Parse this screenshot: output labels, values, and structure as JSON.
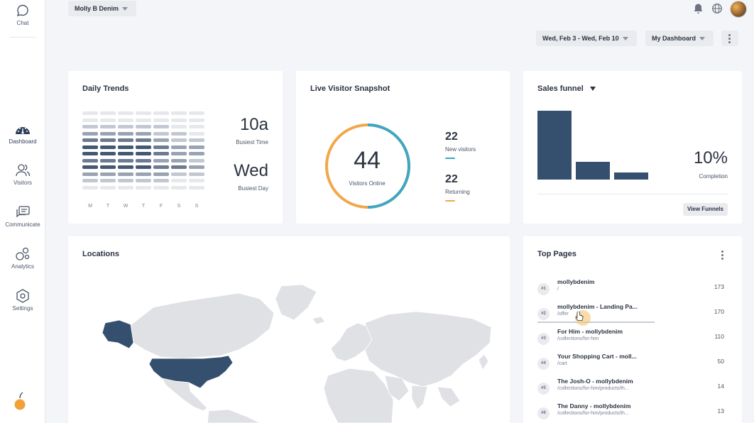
{
  "sidebar": {
    "items": [
      {
        "label": "Chat",
        "icon": "chat-bubble-icon"
      },
      {
        "label": "Dashboard",
        "icon": "speedometer-icon"
      },
      {
        "label": "Visitors",
        "icon": "users-icon"
      },
      {
        "label": "Communicate",
        "icon": "message-icon"
      },
      {
        "label": "Analytics",
        "icon": "bubbles-icon"
      },
      {
        "label": "Settings",
        "icon": "hexagon-gear-icon"
      }
    ],
    "logo_icon": "orange-fruit-logo"
  },
  "header": {
    "site_select": "Molly B Denim",
    "date_range": "Wed, Feb 3 - Wed, Feb 10",
    "dashboard_select": "My Dashboard"
  },
  "daily_trends": {
    "title": "Daily Trends",
    "days": [
      "M",
      "T",
      "W",
      "T",
      "F",
      "S",
      "S"
    ],
    "busiest_time": "10a",
    "busiest_time_label": "Busiest Time",
    "busiest_day": "Wed",
    "busiest_day_label": "Busiest Day",
    "heat_levels": [
      [
        0,
        0,
        0,
        0,
        0,
        0,
        0
      ],
      [
        0,
        0,
        0,
        0,
        0,
        0,
        0
      ],
      [
        1,
        1,
        1,
        1,
        1,
        0,
        0
      ],
      [
        2,
        2,
        2,
        2,
        1,
        1,
        0
      ],
      [
        3,
        3,
        3,
        3,
        2,
        1,
        1
      ],
      [
        4,
        4,
        4,
        4,
        3,
        2,
        2
      ],
      [
        4,
        4,
        4,
        4,
        3,
        2,
        2
      ],
      [
        3,
        3,
        3,
        3,
        2,
        2,
        1
      ],
      [
        4,
        4,
        4,
        4,
        3,
        3,
        2
      ],
      [
        2,
        2,
        2,
        2,
        2,
        1,
        1
      ],
      [
        1,
        1,
        1,
        1,
        1,
        0,
        0
      ],
      [
        0,
        0,
        0,
        0,
        0,
        0,
        0
      ]
    ],
    "heat_colors": [
      "#e6e8ec",
      "#c2c8d2",
      "#9aa3b2",
      "#6d7a8f",
      "#445873"
    ]
  },
  "live_visitors": {
    "title": "Live Visitor Snapshot",
    "total": "44",
    "total_label": "Visitors Online",
    "new_count": "22",
    "new_label": "New visitors",
    "new_color": "#3fa6c4",
    "returning_count": "22",
    "returning_label": "Returning",
    "returning_color": "#f2a74a"
  },
  "sales_funnel": {
    "title": "Sales funnel",
    "stages": [
      1.0,
      0.26,
      0.1
    ],
    "completion": "10%",
    "completion_label": "Completion",
    "view_button": "View Funnels",
    "bar_color": "#35506f"
  },
  "locations": {
    "title": "Locations",
    "highlight_color": "#35506f",
    "land_color": "#dfe1e5"
  },
  "top_pages": {
    "title": "Top Pages",
    "rows": [
      {
        "rank": "#1",
        "title": "mollybdenim",
        "path": "/",
        "count": "173"
      },
      {
        "rank": "#2",
        "title": "mollybdenim - Landing Pa...",
        "path": "/offer",
        "count": "170"
      },
      {
        "rank": "#3",
        "title": "For Him - mollybdenim",
        "path": "/collections/for-him",
        "count": "110"
      },
      {
        "rank": "#4",
        "title": "Your Shopping Cart - moll...",
        "path": "/cart",
        "count": "50"
      },
      {
        "rank": "#5",
        "title": "The Josh-O - mollybdenim",
        "path": "/collections/for-him/products/th...",
        "count": "14"
      },
      {
        "rank": "#6",
        "title": "The Danny - mollybdenim",
        "path": "/collections/for-him/products/th...",
        "count": "13"
      }
    ]
  }
}
